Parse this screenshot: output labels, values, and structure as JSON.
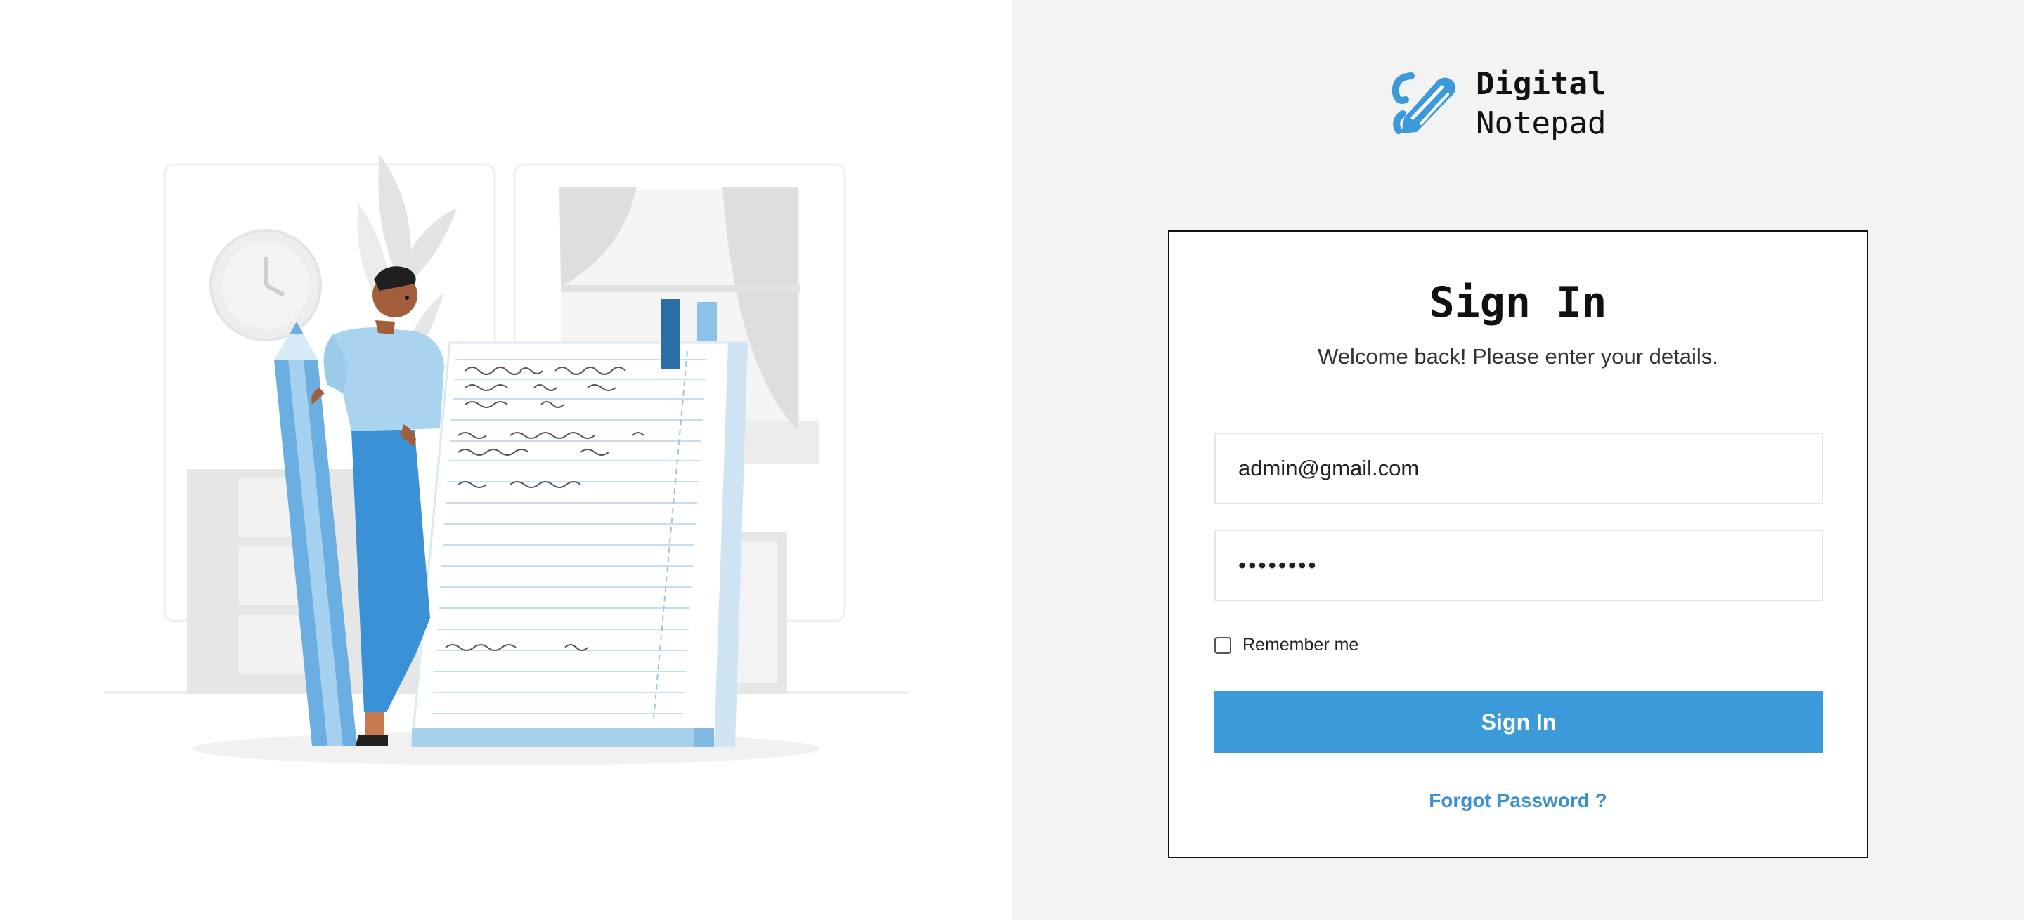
{
  "brand": {
    "line1": "Digital",
    "line2": "Notepad",
    "accent_color": "#3c99da"
  },
  "signin": {
    "title": "Sign In",
    "subtitle": "Welcome back! Please enter your details.",
    "email_value": "admin@gmail.com",
    "password_masked": "••••••••",
    "remember_label": "Remember me",
    "remember_checked": false,
    "submit_label": "Sign In",
    "forgot_label": "Forgot Password ?"
  },
  "icons": {
    "logo": "pencil-logo-icon",
    "checkbox": "checkbox-icon"
  },
  "colors": {
    "left_background": "#ffffff",
    "right_background": "#f3f3f3",
    "button": "#3c99da",
    "link": "#3b90d3"
  }
}
